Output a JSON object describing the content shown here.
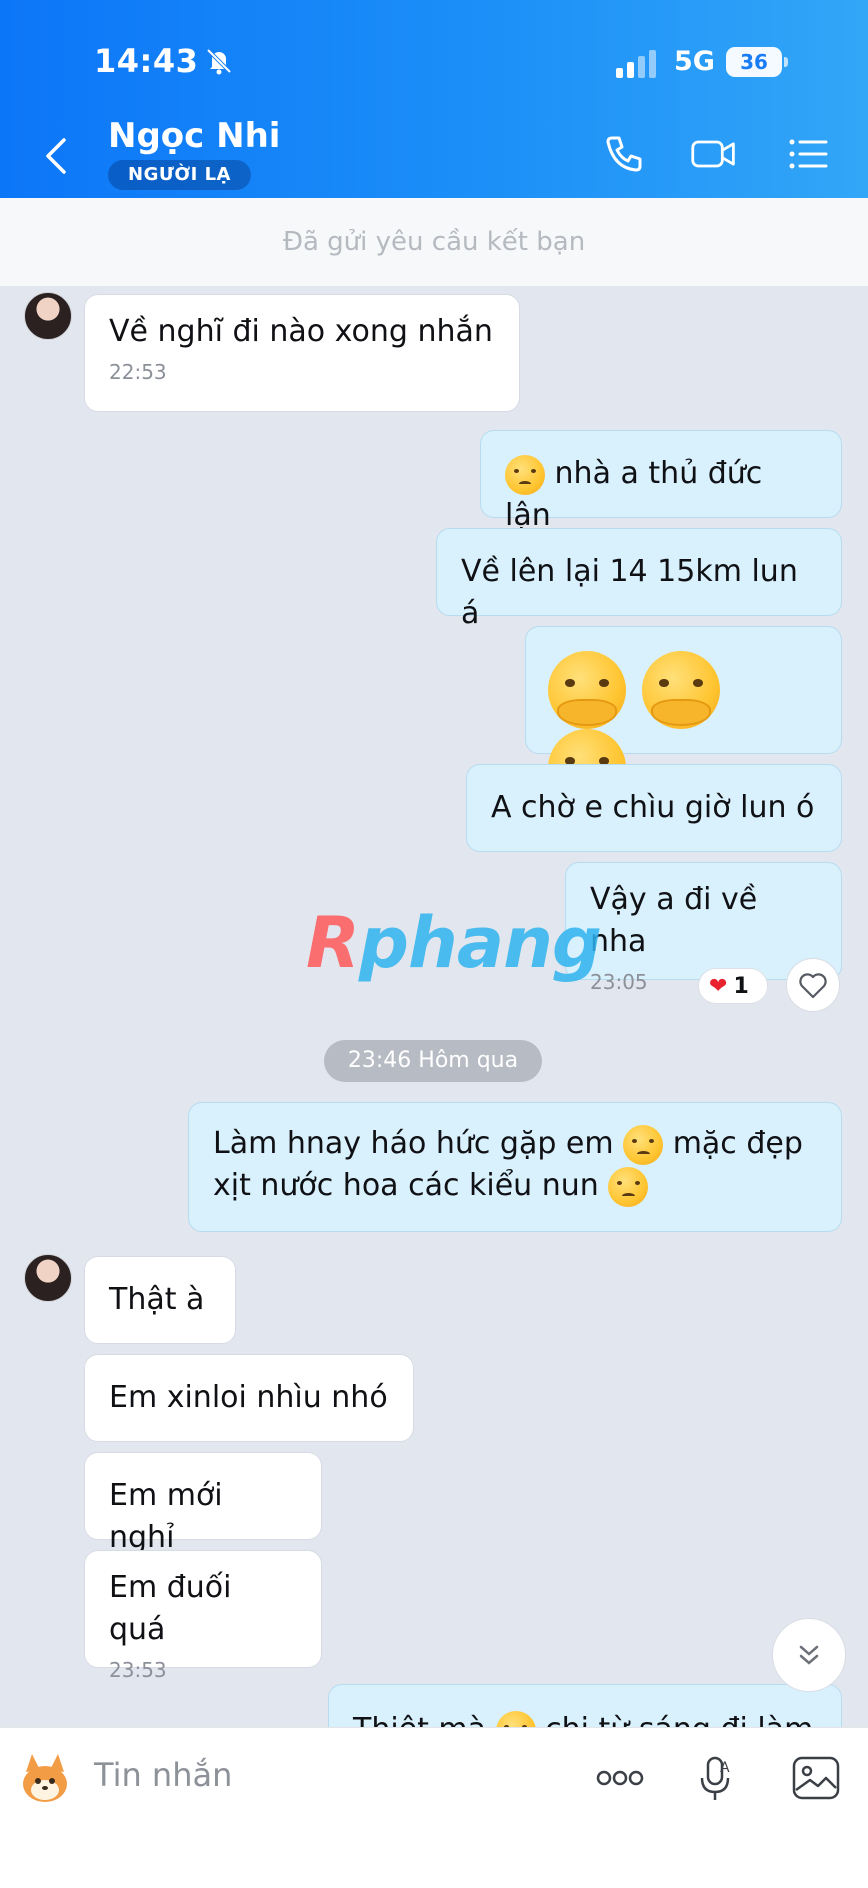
{
  "status_bar": {
    "time": "14:43",
    "network": "5G",
    "battery": "36"
  },
  "header": {
    "contact_name": "Ngọc Nhi",
    "badge": "NGƯỜI LẠ"
  },
  "notice": "Đã gửi yêu cầu kết bạn",
  "messages": [
    {
      "from": "them",
      "text": "Về nghĩ đi nào xong nhắn",
      "time": "22:53"
    },
    {
      "from": "me",
      "text": "nhà a thủ đức lận",
      "emoji": "squinting-face"
    },
    {
      "from": "me",
      "text": "Về lên lại 14 15km lun á"
    },
    {
      "from": "me",
      "emoji": "pleading-hands-face",
      "count": 3
    },
    {
      "from": "me",
      "text": "A chờ e chìu giờ lun ó"
    },
    {
      "from": "me",
      "text": "Vậy a đi về nha",
      "time": "23:05"
    },
    {
      "from": "me",
      "text_1": "Làm hnay háo hức gặp em",
      "text_2": "mặc đẹp",
      "text_3": "xịt nước hoa các kiểu nun",
      "emoji": "sad-face"
    },
    {
      "from": "them",
      "text": "Thật à"
    },
    {
      "from": "them",
      "text": "Em xinloi nhìu nhó"
    },
    {
      "from": "them",
      "text": "Em mới nghỉ"
    },
    {
      "from": "them",
      "text": "Em đuối quá",
      "time": "23:53"
    },
    {
      "from": "me",
      "text_1": "Thiệt mà",
      "text_2": "chị từ sáng đi làm",
      "emoji": "sad-face"
    }
  ],
  "reaction": {
    "icon": "heart",
    "count": "1"
  },
  "date_chip": "23:46 Hôm qua",
  "watermark": {
    "part1": "R",
    "part2": "phang"
  },
  "input": {
    "placeholder": "Tin nhắn"
  },
  "colors": {
    "header_start": "#0c76f8",
    "header_end": "#32a6f7",
    "bubble_out": "#d9f0fd",
    "bubble_in": "#ffffff",
    "heart": "#e8232f"
  }
}
